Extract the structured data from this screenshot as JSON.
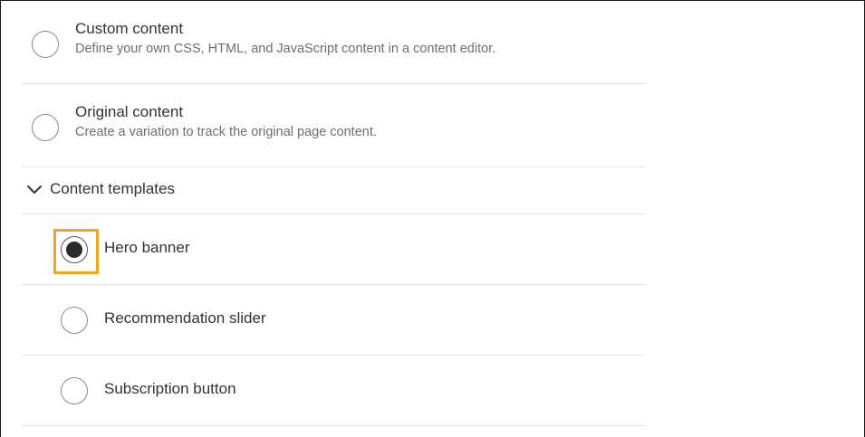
{
  "options": [
    {
      "title": "Custom content",
      "description": "Define your own CSS, HTML, and JavaScript content in a content editor.",
      "selected": false
    },
    {
      "title": "Original content",
      "description": "Create a variation to track the original page content.",
      "selected": false
    }
  ],
  "templates_group": {
    "label": "Content templates",
    "expanded": true,
    "icon": "chevron-down-icon",
    "items": [
      {
        "label": "Hero banner",
        "selected": true
      },
      {
        "label": "Recommendation slider",
        "selected": false
      },
      {
        "label": "Subscription button",
        "selected": false
      }
    ]
  },
  "colors": {
    "focus_ring": "#f5a31a",
    "divider": "#e4e4e4",
    "radio_selected_dot": "#2b2b2b"
  }
}
